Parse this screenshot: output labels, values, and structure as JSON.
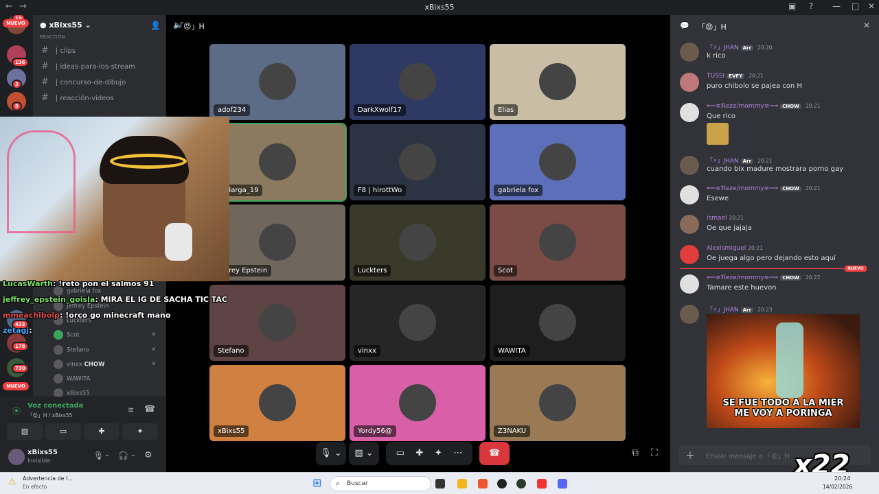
{
  "window": {
    "title": "xBixs55",
    "back": "←",
    "forward": "→"
  },
  "servers": {
    "badges": [
      "19",
      "136",
      "3",
      "9",
      "433",
      "178",
      "730"
    ],
    "nuevo_label": "NUEVO"
  },
  "sidebar": {
    "server_name": "xBixs55",
    "category": "REACCIÓN",
    "channels": [
      "| clips",
      "| ideas-para-los-stream",
      "| concurso-de-dibujo",
      "| reacción-videos"
    ],
    "voice_members": [
      "gabriela fox",
      "Jeffrey Epstein",
      "Luckters",
      "Scot",
      "Stefano",
      "vinxx",
      "WAWITA",
      "xBixs55"
    ],
    "vinxx_tag": "CHOW"
  },
  "voice_panel": {
    "status": "Voz conectada",
    "channel": "「😡」H / xBixs55"
  },
  "user_panel": {
    "name": "xBixs55",
    "status": "Invisible"
  },
  "stage": {
    "channel": "「😡」H",
    "tiles": [
      {
        "name": "adof234",
        "color": "#5c6b86"
      },
      {
        "name": "DarkXwolf17",
        "color": "#2e3a64"
      },
      {
        "name": "Elias",
        "color": "#c9bea5"
      },
      {
        "name": "rgalarga_19",
        "color": "#8b7a5e"
      },
      {
        "name": "F8 | hirottWo",
        "color": "#2c3443"
      },
      {
        "name": "gabriela fox",
        "color": "#5d6fb8"
      },
      {
        "name": "Jeffrey Epstein",
        "color": "#6f665c"
      },
      {
        "name": "Luckters",
        "color": "#3a3a2a"
      },
      {
        "name": "Scot",
        "color": "#7a4c45"
      },
      {
        "name": "Stefano",
        "color": "#5e4345"
      },
      {
        "name": "vinxx",
        "color": "#262626"
      },
      {
        "name": "WAWITA",
        "color": "#1e1e1e"
      },
      {
        "name": "xBixs55",
        "color": "#d08040"
      },
      {
        "name": "Yordy56@",
        "color": "#d960a8"
      },
      {
        "name": "Z3NAKU",
        "color": "#9a7a55"
      }
    ]
  },
  "stream_chat": [
    {
      "user": "LucasWarth",
      "text": ": !reto pon el salmos 91",
      "color": "#7fe06a"
    },
    {
      "user": "jeffrey_epstein_goisla",
      "text": ": MIRA EL IG DE SACHA TIC TAC",
      "color": "#7fe06a"
    },
    {
      "user": "mmeachibolp",
      "text": ": !orco go minecraft mano",
      "color": "#e05050"
    },
    {
      "user": "zetagj",
      "text": ":",
      "color": "#4aa8ff"
    }
  ],
  "chat": {
    "title": "「😡」H",
    "new_label": "NUEVO",
    "messages": [
      {
        "user": "「⚡」JHAN",
        "tag": "Arr",
        "time": "20:20",
        "text": "k rico"
      },
      {
        "user": "TUSSI",
        "tag": "EVFY",
        "time": "20:21",
        "text": "puro chibolo se pajea con H"
      },
      {
        "user": "⟸≡ℜeze/mommy≡⟹",
        "tag": "CHOW",
        "time": "20:21",
        "text": "Que rico"
      },
      {
        "user": "「⚡」JHAN",
        "tag": "Arr",
        "time": "20:21",
        "text": "cuando bix madure mostrara porno gay"
      },
      {
        "user": "⟸≡ℜeze/mommy≡⟹",
        "tag": "CHOW",
        "time": "20:21",
        "text": "Esewe"
      },
      {
        "user": "ismael",
        "tag": "",
        "time": "20:21",
        "text": "Oe que jajaja"
      },
      {
        "user": "Alexismiguel",
        "tag": "",
        "time": "20:21",
        "text": "Oe juega algo pero dejando esto aquí"
      },
      {
        "user": "⟸≡ℜeze/mommy≡⟹",
        "tag": "CHOW",
        "time": "20:22",
        "text": "Tamare este huevon"
      },
      {
        "user": "「⚡」JHAN",
        "tag": "Arr",
        "time": "20:23",
        "text": ""
      }
    ],
    "gif_caption": "SE FUE TODO A LA MIER\nME VOY A PORINGA",
    "input_placeholder": "Enviar mensaje a 「😡」H",
    "overlay": "x22"
  },
  "taskbar": {
    "notification_title": "Advertencia de l...",
    "notification_sub": "En efecto",
    "search": "Buscar",
    "time": "20:24",
    "date": "14/02/2026"
  }
}
